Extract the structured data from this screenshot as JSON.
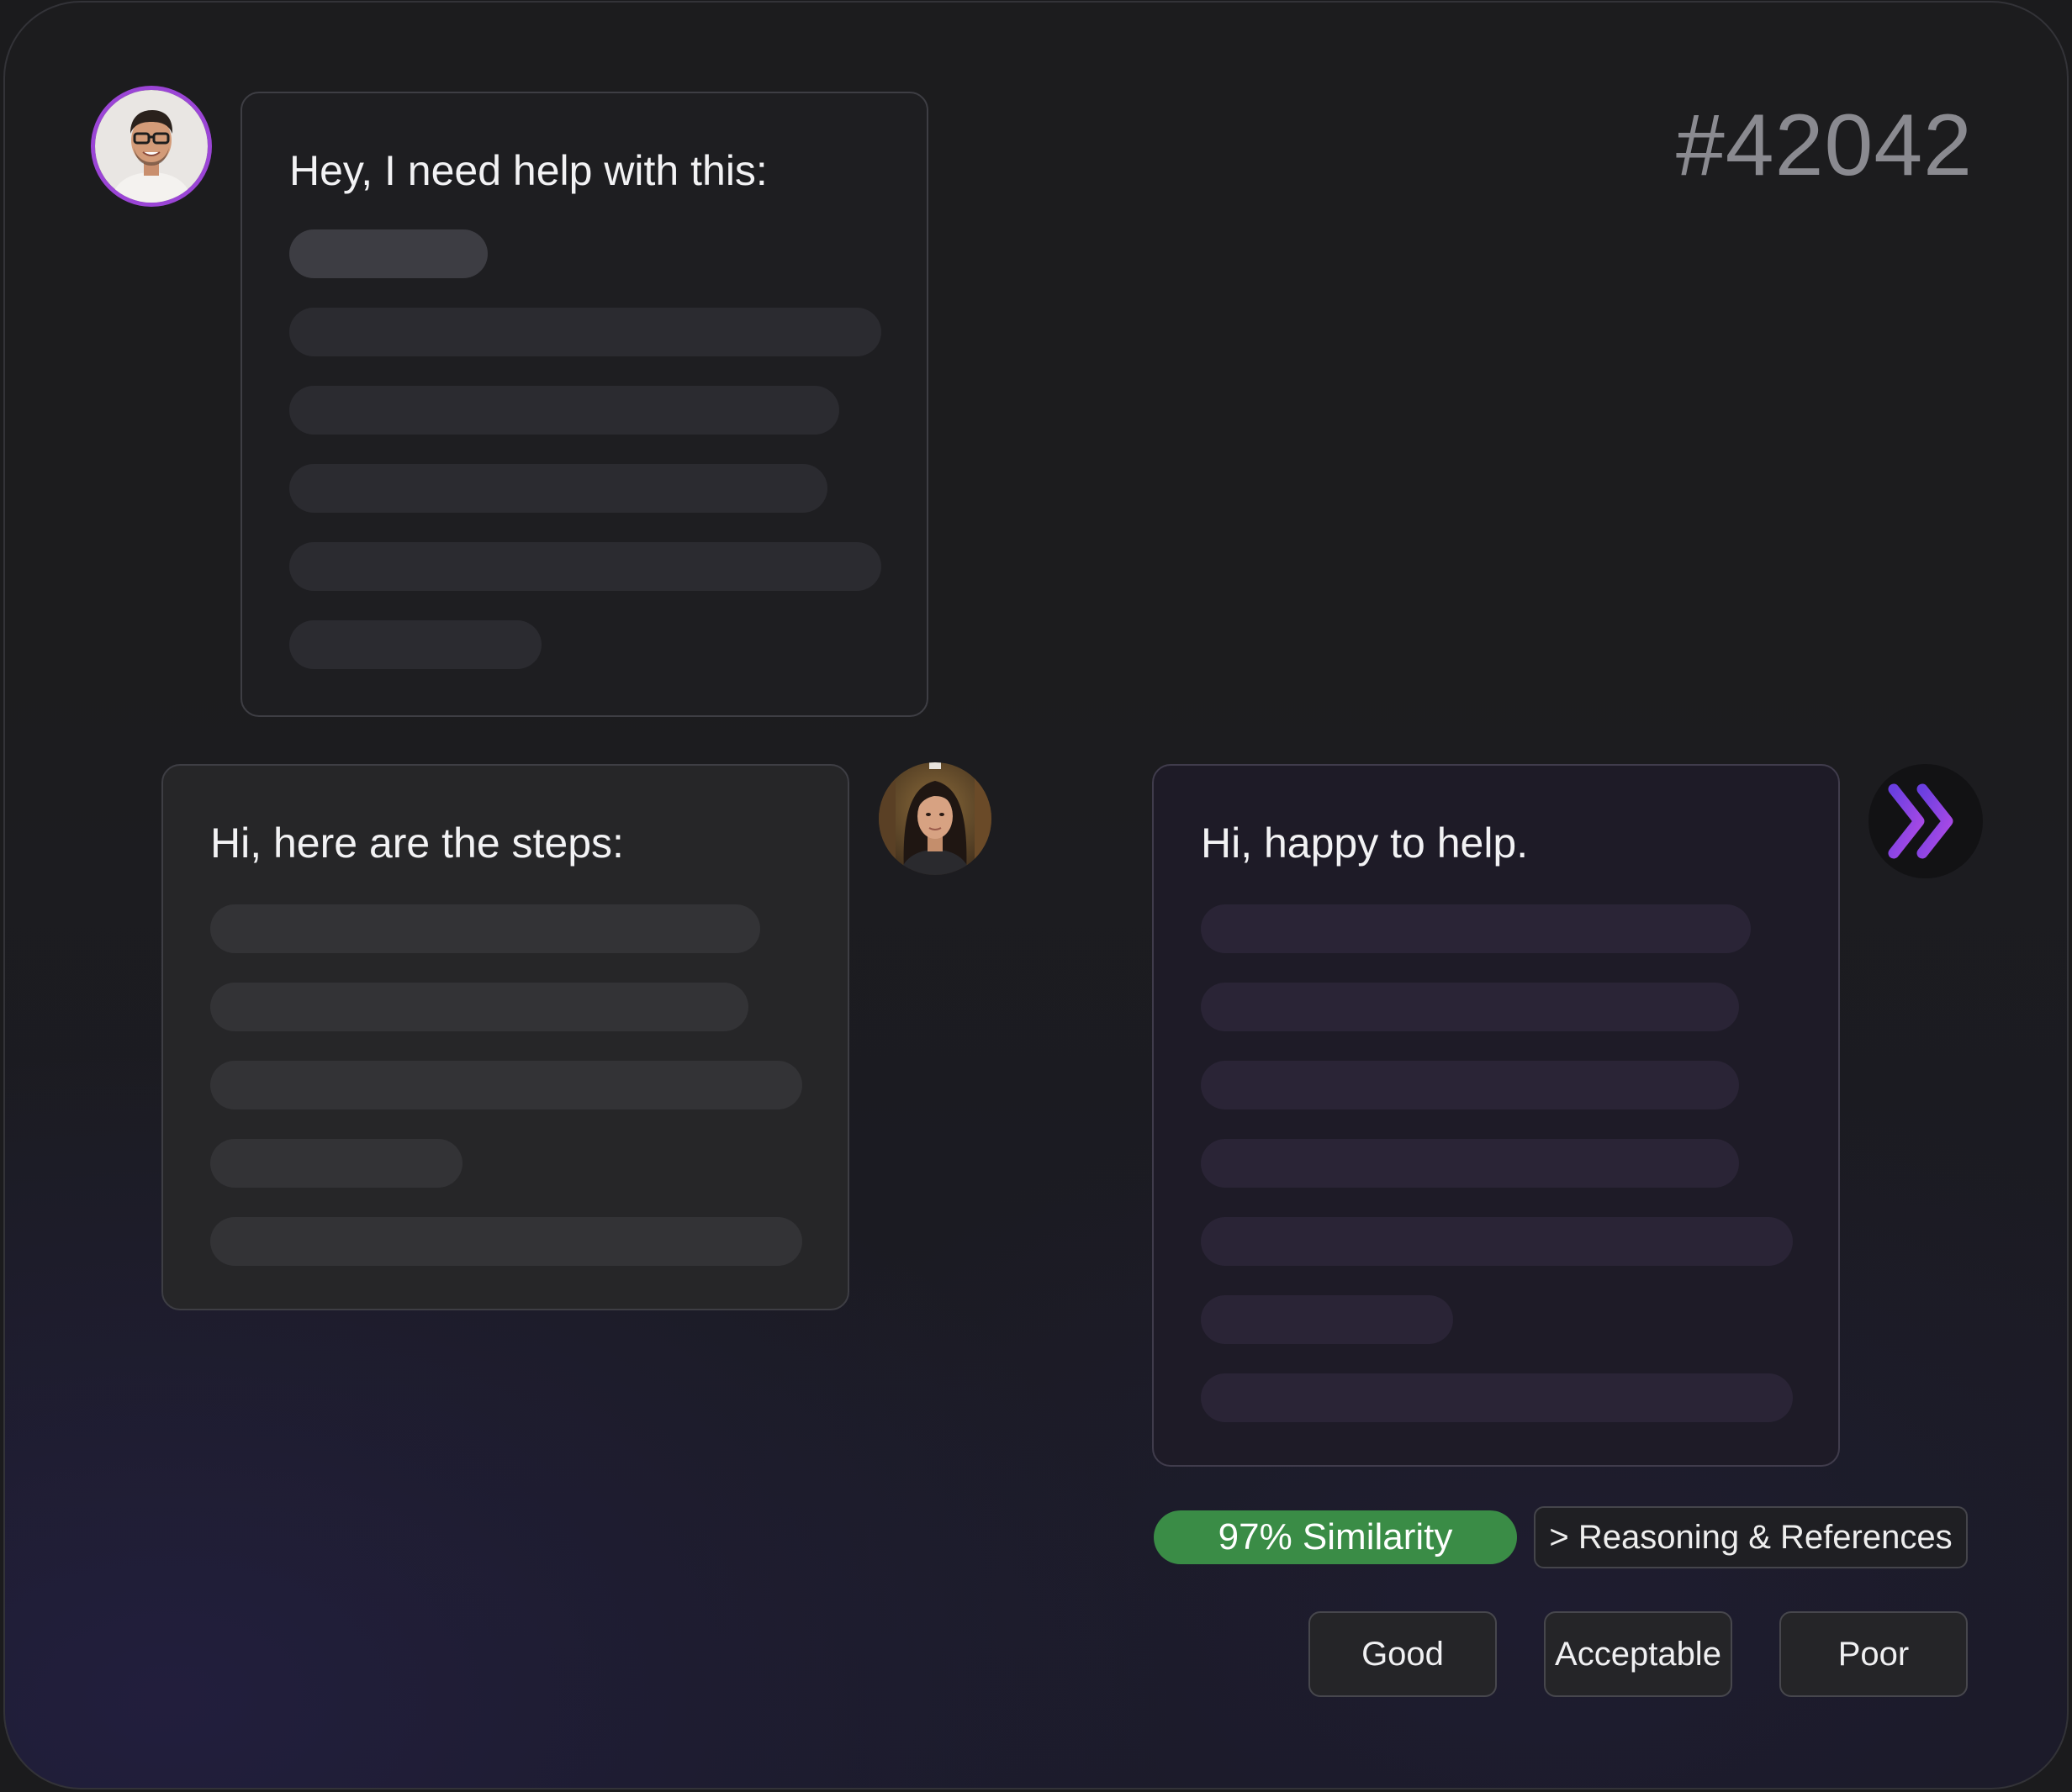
{
  "ticket": {
    "id": "#42042"
  },
  "user_message": {
    "avatar": "user-avatar",
    "title": "Hey, I need help with this:"
  },
  "agent_message": {
    "avatar": "agent-avatar",
    "title": "Hi, here are the steps:"
  },
  "ai_message": {
    "avatar": "double-chevron-right-icon",
    "title": "Hi, happy to help."
  },
  "similarity": {
    "label": "97% Similarity",
    "value": 97
  },
  "reasoning": {
    "label": "> Reasoning & References"
  },
  "rating": {
    "good": "Good",
    "acceptable": "Acceptable",
    "poor": "Poor"
  },
  "colors": {
    "accent_purple": "#9b45d6",
    "similarity_green": "#3a8c46",
    "background": "#1c1c1e"
  }
}
